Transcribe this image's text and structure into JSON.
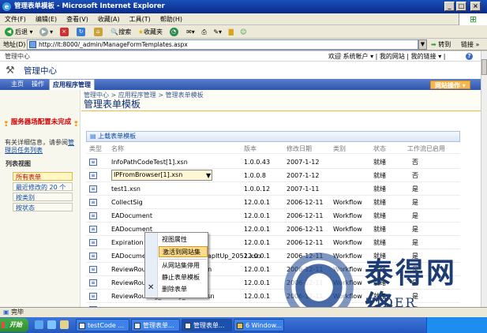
{
  "window": {
    "title": "管理表单模板 - Microsoft Internet Explorer",
    "min": "_",
    "max": "□",
    "close": "×"
  },
  "menu": [
    "文件(F)",
    "编辑(E)",
    "查看(V)",
    "收藏(A)",
    "工具(T)",
    "帮助(H)"
  ],
  "toolbar": {
    "back": "后退",
    "search": "搜索",
    "favorites": "收藏夹"
  },
  "address": {
    "label": "地址(D)",
    "url": "http://lt:8000/_admin/ManageFormTemplates.aspx",
    "go": "转到",
    "links": "链接"
  },
  "sp": {
    "site_crumb": "管理中心",
    "welcome": "欢迎 系统帐户 ▾  |  我的网站  |  我的链接 ▾  |",
    "help": "?",
    "header_title": "管理中心",
    "tabs": [
      "主页",
      "操作",
      "应用程序管理"
    ],
    "site_actions": "网站操作 ▾",
    "breadcrumb": "管理中心 > 应用程序管理 > 管理表单模板",
    "page_title": "管理表单模板",
    "alert_title": "服务器场配置未完成",
    "alert_detail_prefix": "有关详细信息，请参阅",
    "alert_link": "管理员任务列表",
    "list_views_label": "列表视图",
    "views": [
      "所有表单",
      "最近修改的 20 个",
      "按类别",
      "按状态"
    ],
    "upload": "上载表单模板",
    "columns": [
      "类型",
      "名称",
      "版本",
      "修改日期",
      "类别",
      "状态",
      "工作流已启用"
    ],
    "rows": [
      {
        "name": "InfoPathCodeTest[1].xsn",
        "version": "1.0.0.43",
        "date": "2007-1-12",
        "category": "",
        "status": "就绪",
        "workflow": "否"
      },
      {
        "name": "IPFromBrowser[1].xsn",
        "version": "1.0.0.8",
        "date": "2007-1-12",
        "category": "",
        "status": "就绪",
        "workflow": "否"
      },
      {
        "name": "test1.xsn",
        "version": "1.0.0.12",
        "date": "2007-1-11",
        "category": "",
        "status": "就绪",
        "workflow": "是"
      },
      {
        "name": "CollectSig",
        "version": "12.0.0.1",
        "date": "2006-12-11",
        "category": "Workflow",
        "status": "就绪",
        "workflow": "是"
      },
      {
        "name": "EADocument",
        "version": "12.0.0.1",
        "date": "2006-12-11",
        "category": "Workflow",
        "status": "就绪",
        "workflow": "是"
      },
      {
        "name": "EADocument",
        "version": "12.0.0.1",
        "date": "2006-12-11",
        "category": "Workflow",
        "status": "就绪",
        "workflow": "是"
      },
      {
        "name": "Expiration",
        "version": "12.0.0.1",
        "date": "2006-12-11",
        "category": "Workflow",
        "status": "就绪",
        "workflow": "是"
      },
      {
        "name": "EADocumentApproval_00B_WrapItUp_2052.xsn",
        "version": "12.0.0.1",
        "date": "2006-12-11",
        "category": "Workflow",
        "status": "就绪",
        "workflow": "是"
      },
      {
        "name": "ReviewRouting_Assoc_2052.xsn",
        "version": "12.0.0.1",
        "date": "2006-12-11",
        "category": "Workflow",
        "status": "就绪",
        "workflow": "是"
      },
      {
        "name": "ReviewRouting_Init_2052.xsn",
        "version": "12.0.0.1",
        "date": "2006-12-11",
        "category": "Workflow",
        "status": "就绪",
        "workflow": "是"
      },
      {
        "name": "ReviewRouting_Modify_2052.xsn",
        "version": "12.0.0.1",
        "date": "2006-12-11",
        "category": "Workflow",
        "status": "就绪",
        "workflow": "是"
      },
      {
        "name": "ReviewRouting_Review_2052.xsn",
        "version": "12.0.0.1",
        "date": "2006-12-11",
        "category": "Workflow",
        "status": "就绪",
        "workflow": "是"
      }
    ],
    "menu_items": [
      "视图属性",
      "激活到网站集",
      "从网站集停用",
      "静止表单模板",
      "删除表单"
    ]
  },
  "status": "完毕",
  "taskbar": {
    "start": "开始",
    "tasks": [
      "testCode ...",
      "管理表单...",
      "管理表单...",
      "6 Window..."
    ]
  },
  "watermark": {
    "cn": "泰得网络",
    "en": "TIDER NETWORKS"
  },
  "colors": {
    "accent": "#f5b74e",
    "title_blue": "#0c2e7a",
    "alert_red": "#c00000"
  }
}
